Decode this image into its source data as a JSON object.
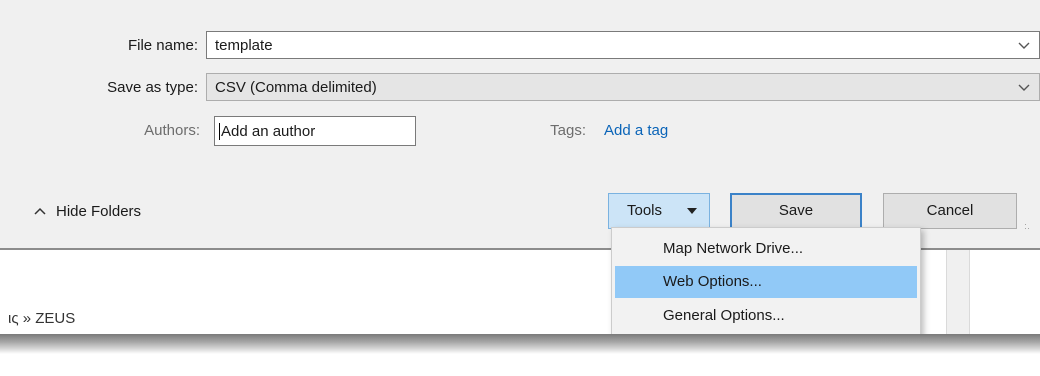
{
  "fields": {
    "file_name_label": "File name:",
    "file_name_value": "template",
    "save_type_label": "Save as type:",
    "save_type_value": "CSV (Comma delimited)",
    "authors_label": "Authors:",
    "authors_value": "Add an author",
    "tags_label": "Tags:",
    "tags_value": "Add a tag"
  },
  "footer": {
    "hide_folders_label": "Hide Folders",
    "tools_label": "Tools",
    "save_label": "Save",
    "cancel_label": "Cancel"
  },
  "tools_menu": {
    "items": [
      {
        "label": "Map Network Drive..."
      },
      {
        "label": "Web Options..."
      },
      {
        "label": "General Options..."
      }
    ],
    "highlighted": "Web Options..."
  },
  "breadcrumb": {
    "text": "ις » ZEUS"
  },
  "icons": {
    "combo_dropdown": "chevron-down-icon",
    "tools_dropdown": "caret-down-icon",
    "hide_folders": "chevron-up-icon"
  }
}
